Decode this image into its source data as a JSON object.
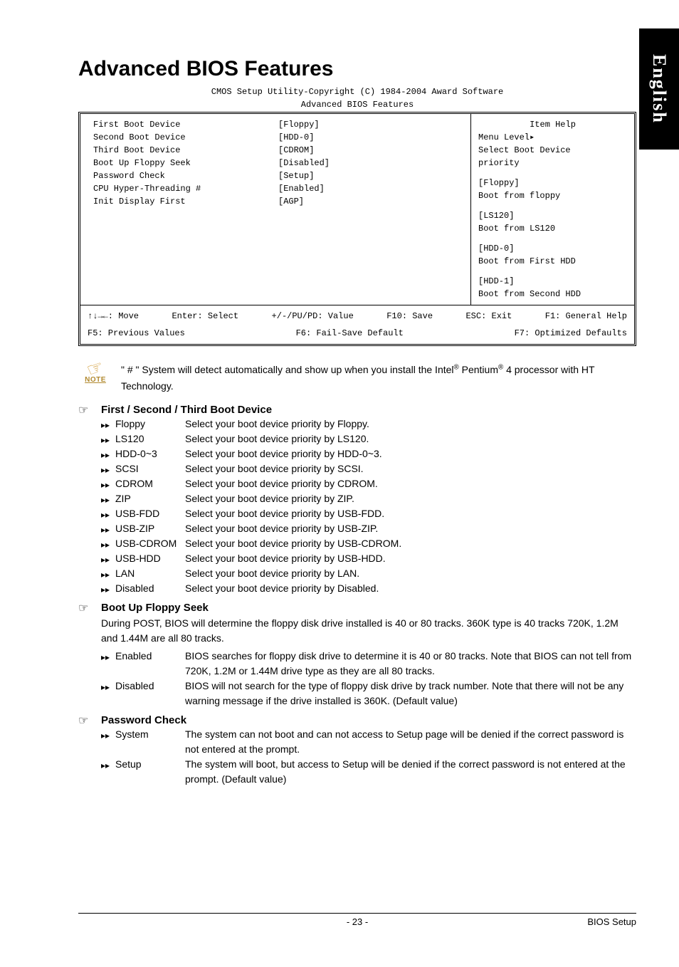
{
  "side_tab": "English",
  "title": "Advanced BIOS Features",
  "bios": {
    "header_line1": "CMOS Setup Utility-Copyright (C) 1984-2004 Award Software",
    "header_line2": "Advanced BIOS Features",
    "settings": [
      {
        "label": "First Boot Device",
        "value": "[Floppy]"
      },
      {
        "label": "Second Boot Device",
        "value": "[HDD-0]"
      },
      {
        "label": "Third Boot Device",
        "value": "[CDROM]"
      },
      {
        "label": "Boot Up Floppy Seek",
        "value": "[Disabled]"
      },
      {
        "label": "Password Check",
        "value": "[Setup]"
      },
      {
        "label": "CPU Hyper-Threading #",
        "value": "[Enabled]"
      },
      {
        "label": "Init Display First",
        "value": "[AGP]"
      }
    ],
    "help": {
      "title": "Item Help",
      "menu_level": "Menu Level▸",
      "line1": "Select Boot Device",
      "line2": "priority",
      "blocks": [
        {
          "hdr": "[Floppy]",
          "txt": "Boot from floppy"
        },
        {
          "hdr": "[LS120]",
          "txt": "Boot from LS120"
        },
        {
          "hdr": "[HDD-0]",
          "txt": "Boot from First HDD"
        },
        {
          "hdr": "[HDD-1]",
          "txt": "Boot from Second HDD"
        }
      ]
    },
    "footer": {
      "move": "↑↓→←: Move",
      "enter": "Enter: Select",
      "value": "+/-/PU/PD: Value",
      "save": "F10: Save",
      "esc": "ESC: Exit",
      "f1": "F1: General Help",
      "f5": "F5: Previous Values",
      "f6": "F6: Fail-Save Default",
      "f7": "F7: Optimized Defaults"
    }
  },
  "note": {
    "label": "NOTE",
    "text_before": "\" # \" System will detect automatically and show up when you install the Intel",
    "reg1": "®",
    "pentium": " Pentium",
    "reg2": "®",
    "after": " 4 processor with HT Technology."
  },
  "sections": [
    {
      "title": "First / Second / Third Boot Device",
      "options": [
        {
          "name": "Floppy",
          "desc": "Select your boot device priority by Floppy."
        },
        {
          "name": "LS120",
          "desc": "Select your boot device priority by LS120."
        },
        {
          "name": "HDD-0~3",
          "desc": "Select your boot device priority by HDD-0~3."
        },
        {
          "name": "SCSI",
          "desc": "Select your boot device priority by SCSI."
        },
        {
          "name": "CDROM",
          "desc": "Select your boot device priority by CDROM."
        },
        {
          "name": "ZIP",
          "desc": "Select your boot device priority by ZIP."
        },
        {
          "name": "USB-FDD",
          "desc": "Select your boot device priority by USB-FDD."
        },
        {
          "name": "USB-ZIP",
          "desc": "Select your boot device priority by USB-ZIP."
        },
        {
          "name": "USB-CDROM",
          "desc": "Select your boot device priority by USB-CDROM."
        },
        {
          "name": "USB-HDD",
          "desc": "Select your boot device priority by USB-HDD."
        },
        {
          "name": "LAN",
          "desc": "Select your boot device priority by LAN."
        },
        {
          "name": "Disabled",
          "desc": "Select your boot device priority by Disabled."
        }
      ]
    },
    {
      "title": "Boot Up Floppy Seek",
      "para": "During POST, BIOS will determine the floppy disk drive installed is 40 or 80 tracks. 360K type is 40 tracks 720K, 1.2M and 1.44M are all 80 tracks.",
      "options": [
        {
          "name": "Enabled",
          "desc": "BIOS searches for floppy disk drive to determine it is 40 or 80 tracks. Note that BIOS can not tell from 720K, 1.2M or 1.44M drive type as they are all 80 tracks."
        },
        {
          "name": "Disabled",
          "desc": "BIOS will not search for the type of floppy disk drive by track number. Note that there will not be any warning message if the drive installed is 360K. (Default value)"
        }
      ]
    },
    {
      "title": "Password Check",
      "options": [
        {
          "name": "System",
          "desc": "The system can not boot and can not access to Setup page will be denied if the correct password is not entered at the prompt."
        },
        {
          "name": "Setup",
          "desc": "The system will boot, but access to Setup will be denied if the correct password is not entered at the prompt. (Default value)"
        }
      ]
    }
  ],
  "footer": {
    "page": "- 23 -",
    "section": "BIOS Setup"
  }
}
